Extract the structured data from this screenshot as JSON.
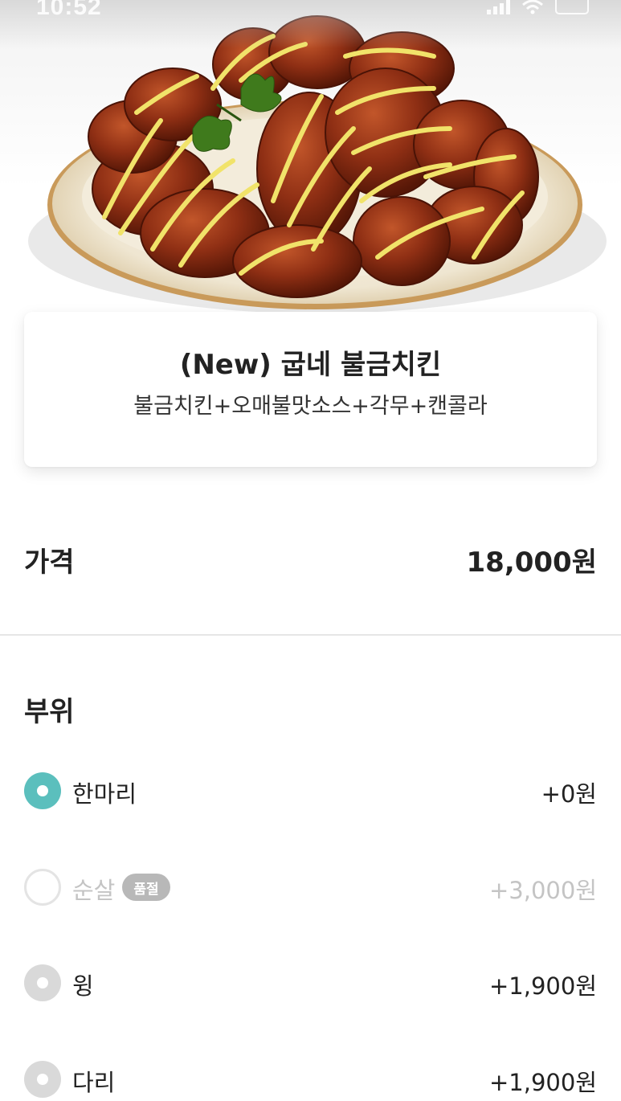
{
  "status_bar": {
    "time": "10:52",
    "icons": [
      "location-arrow-icon",
      "signal-icon",
      "wifi-icon",
      "battery-icon"
    ]
  },
  "hero": {
    "image": "chicken-platter-image"
  },
  "product": {
    "title": "(New) 굽네 불금치킨",
    "description": "불금치킨+오매불맛소스+각무+캔콜라"
  },
  "price": {
    "label": "가격",
    "value": "18,000원"
  },
  "options_section": {
    "title": "부위",
    "accent_color": "#5bbfbd",
    "items": [
      {
        "label": "한마리",
        "price": "+0원",
        "state": "selected"
      },
      {
        "label": "순살",
        "badge": "품절",
        "price": "+3,000원",
        "state": "sold-out"
      },
      {
        "label": "윙",
        "price": "+1,900원",
        "state": "unselected"
      },
      {
        "label": "다리",
        "price": "+1,900원",
        "state": "unselected"
      }
    ]
  }
}
